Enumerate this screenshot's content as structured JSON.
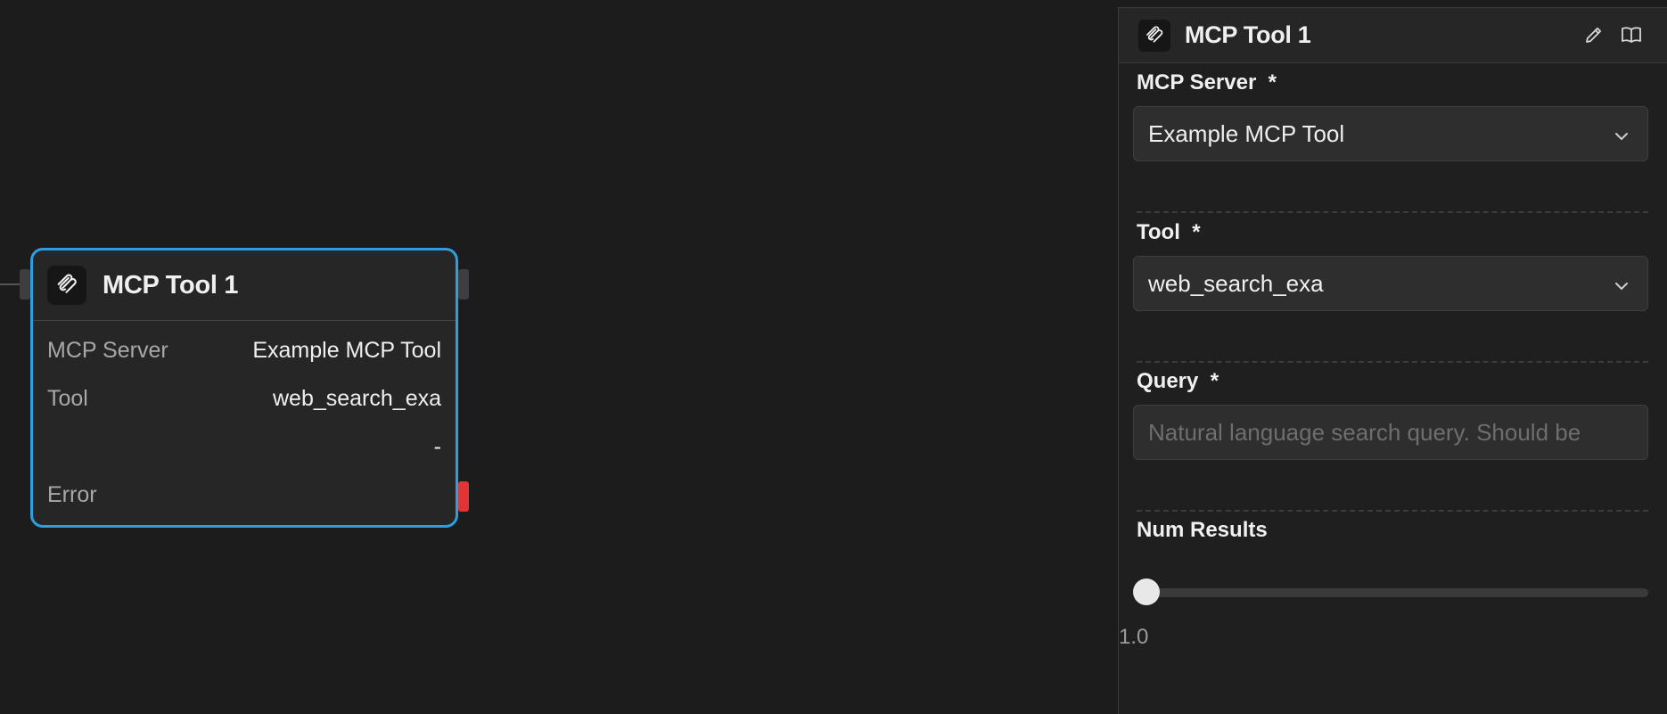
{
  "node": {
    "title": "MCP Tool 1",
    "icon": "mcp-icon",
    "rows": [
      {
        "key": "MCP Server",
        "value": "Example MCP Tool"
      },
      {
        "key": "Tool",
        "value": "web_search_exa"
      },
      {
        "key": "",
        "value": "-"
      },
      {
        "key": "Error",
        "value": ""
      }
    ],
    "border_color": "#2d9fe0",
    "error_handle_color": "#e03535"
  },
  "panel": {
    "title": "MCP Tool 1",
    "icon": "mcp-icon",
    "actions": [
      "pencil-icon",
      "book-icon"
    ],
    "mcp_server": {
      "label": "MCP Server",
      "required": "*",
      "value": "Example MCP Tool"
    },
    "tool": {
      "label": "Tool",
      "required": "*",
      "value": "web_search_exa"
    },
    "query": {
      "label": "Query",
      "required": "*",
      "placeholder": "Natural language search query. Should be",
      "value": ""
    },
    "num_results": {
      "label": "Num Results",
      "value": "1.0",
      "fraction": 0
    }
  }
}
